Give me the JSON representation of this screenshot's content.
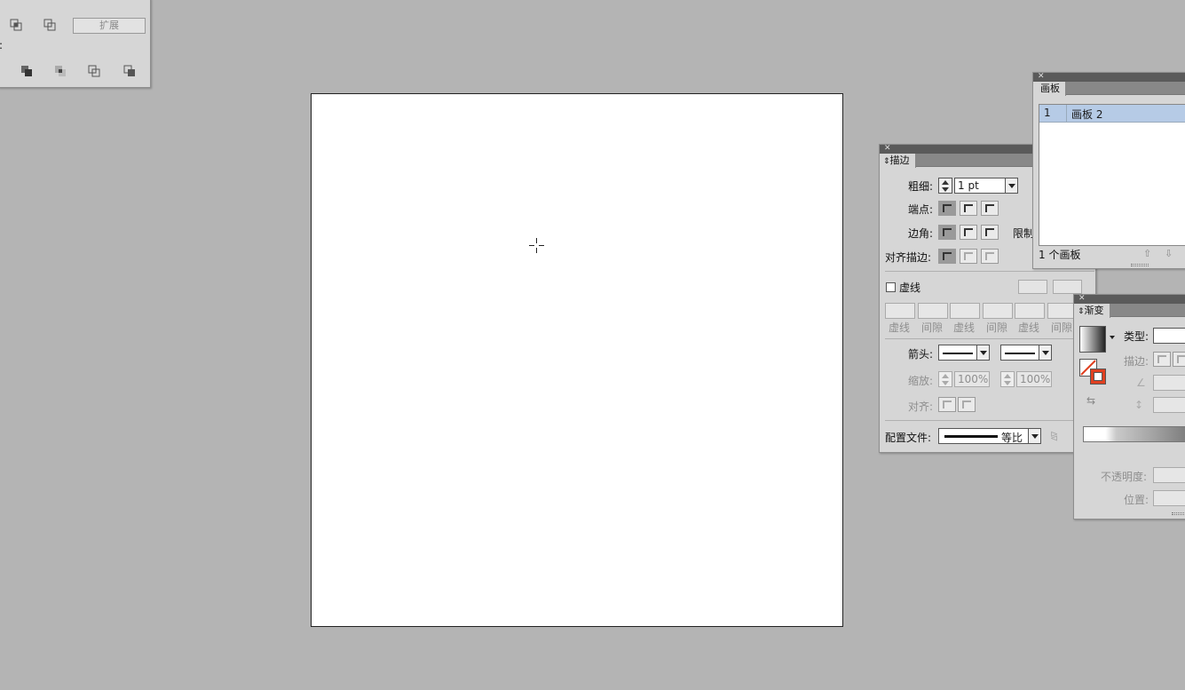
{
  "pathfinder": {
    "expand_label": "扩展",
    "colon": ":"
  },
  "artboards_panel": {
    "tab": "画板",
    "rows": [
      {
        "index": "1",
        "name": "画板 2"
      }
    ],
    "footer": "1 个画板"
  },
  "stroke_panel": {
    "tab": "描边",
    "weight_label": "粗细:",
    "weight_value": "1 pt",
    "cap_label": "端点:",
    "corner_label": "边角:",
    "limit_label": "限制",
    "align_label": "对齐描边:",
    "dashed_label": "虚线",
    "dash_labels": [
      "虚线",
      "间隙",
      "虚线",
      "间隙",
      "虚线",
      "间隙"
    ],
    "arrow_label": "箭头:",
    "scale_label": "缩放:",
    "scale_values": [
      "100%",
      "100%"
    ],
    "align2_label": "对齐:",
    "profile_label": "配置文件:",
    "profile_value": "等比"
  },
  "gradient_panel": {
    "tab": "渐变",
    "type_label": "类型:",
    "stroke_label": "描边:",
    "opacity_label": "不透明度:",
    "position_label": "位置:"
  },
  "colors": {
    "canvas": "#b4b4b4",
    "artboard": "#ffffff",
    "selection": "#b6cbe6",
    "stroke_indicator": "#e04020"
  }
}
